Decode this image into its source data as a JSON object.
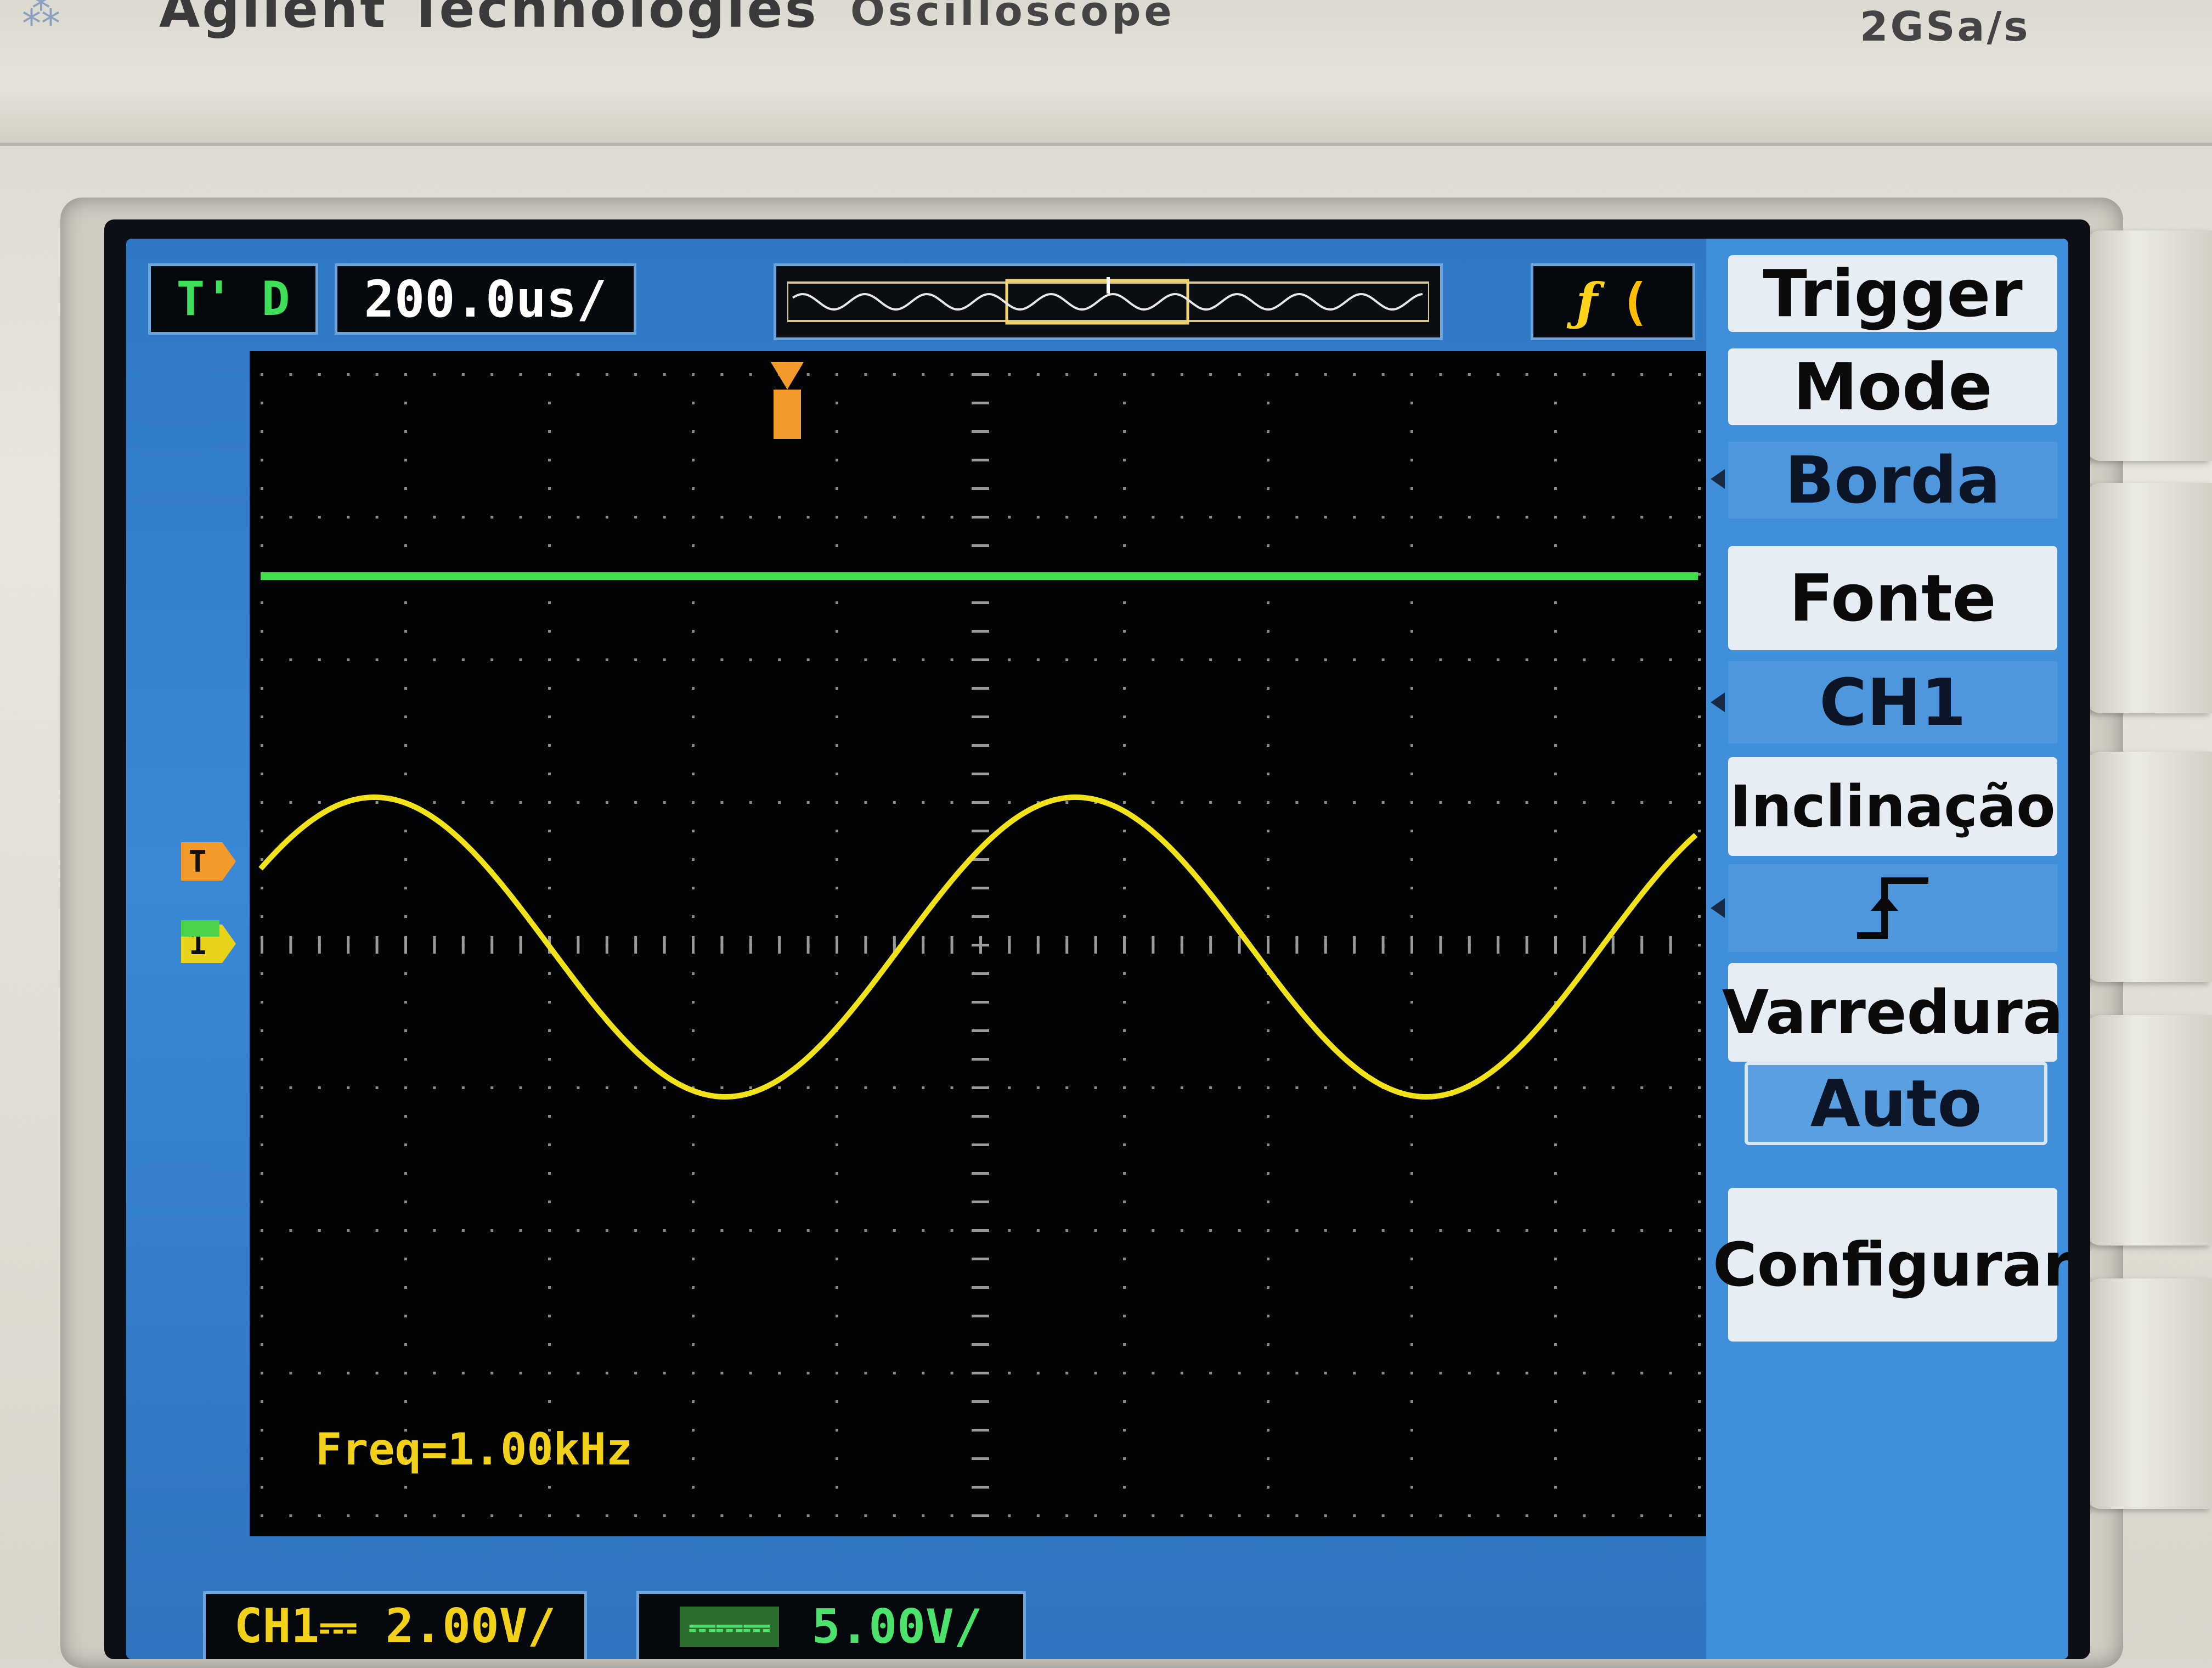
{
  "instrument": {
    "brand": "Agilent Technologies",
    "model": "Oscilloscope",
    "sample_rate": "2GSa/s"
  },
  "header": {
    "acquisition_mode": "T' D",
    "timebase": "200.0us/"
  },
  "measurement": {
    "frequency": "Freq=1.00kHz"
  },
  "markers": {
    "trigger_level": "T",
    "channel_ground": "1"
  },
  "channels": {
    "ch1_scale": "CH1⎓ 2.00V/",
    "ch2_label": "⎓⎓⎓",
    "ch2_scale": "5.00V/"
  },
  "trigger_status": {
    "edge_symbol": "ƒ",
    "level_symbol": "("
  },
  "menu": {
    "title": "Trigger",
    "mode_label": "Mode",
    "mode_value": "Borda",
    "source_label": "Fonte",
    "source_value": "CH1",
    "slope_label": "Inclinação",
    "slope_value_icon": "rising-edge-icon",
    "sweep_label": "Varredura",
    "sweep_value": "Auto",
    "setup_label": "Configurar"
  },
  "colors": {
    "ch1_trace": "#f2e21a",
    "ch2_trace": "#3fe04a",
    "trigger_marker": "#f39a2a",
    "screen_frame": "#3a88d6"
  }
}
